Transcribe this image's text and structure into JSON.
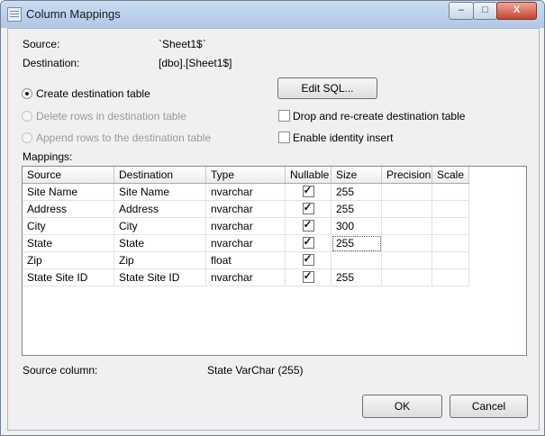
{
  "window": {
    "title": "Column Mappings",
    "minimize": "–",
    "maximize": "□",
    "close": "X"
  },
  "info": {
    "source_label": "Source:",
    "source_value": "`Sheet1$`",
    "destination_label": "Destination:",
    "destination_value": "[dbo].[Sheet1$]"
  },
  "options": {
    "create": "Create destination table",
    "delete": "Delete rows in destination table",
    "append": "Append rows to the destination table",
    "edit_sql": "Edit SQL...",
    "drop_recreate": "Drop and re-create destination table",
    "identity_insert": "Enable identity insert"
  },
  "mappings": {
    "label": "Mappings:",
    "columns": [
      "Source",
      "Destination",
      "Type",
      "Nullable",
      "Size",
      "Precision",
      "Scale"
    ],
    "rows": [
      {
        "source": "Site Name",
        "destination": "Site Name",
        "type": "nvarchar",
        "nullable": true,
        "size": "255",
        "precision": "",
        "scale": ""
      },
      {
        "source": "Address",
        "destination": "Address",
        "type": "nvarchar",
        "nullable": true,
        "size": "255",
        "precision": "",
        "scale": ""
      },
      {
        "source": "City",
        "destination": "City",
        "type": "nvarchar",
        "nullable": true,
        "size": "300",
        "precision": "",
        "scale": ""
      },
      {
        "source": "State",
        "destination": "State",
        "type": "nvarchar",
        "nullable": true,
        "size": "255",
        "precision": "",
        "scale": ""
      },
      {
        "source": "Zip",
        "destination": "Zip",
        "type": "float",
        "nullable": true,
        "size": "",
        "precision": "",
        "scale": ""
      },
      {
        "source": "State Site ID",
        "destination": "State Site ID",
        "type": "nvarchar",
        "nullable": true,
        "size": "255",
        "precision": "",
        "scale": ""
      }
    ]
  },
  "footer": {
    "source_column_label": "Source column:",
    "source_column_value": "State VarChar (255)",
    "ok": "OK",
    "cancel": "Cancel"
  }
}
